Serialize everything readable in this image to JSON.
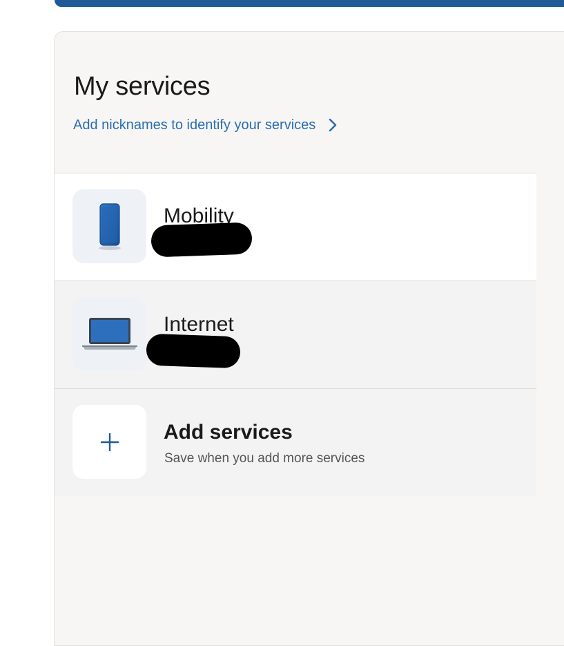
{
  "header": {
    "title": "My services",
    "nickname_link": "Add nicknames to identify your services"
  },
  "services": [
    {
      "label": "Mobility",
      "icon": "smartphone-icon",
      "number": ""
    },
    {
      "label": "Internet",
      "icon": "laptop-icon",
      "number": ""
    }
  ],
  "add_services": {
    "title": "Add services",
    "subtitle": "Save when you add more services",
    "icon": "plus-icon"
  },
  "colors": {
    "brand": "#1d5a96",
    "link": "#2a6db1",
    "card_bg": "#f7f6f4",
    "row_hover": "#f3f3f3"
  }
}
